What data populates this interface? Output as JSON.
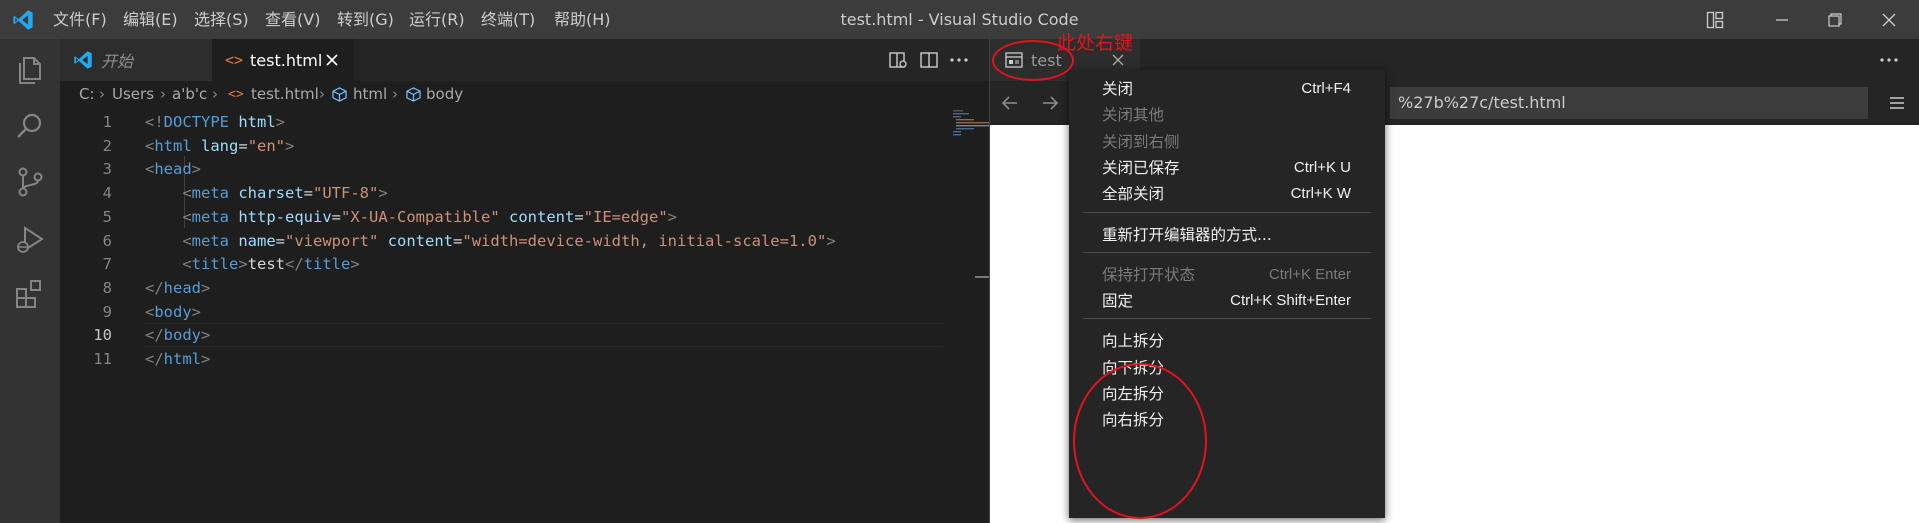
{
  "app": {
    "window_title": "test.html - Visual Studio Code",
    "menu": [
      "文件(F)",
      "编辑(E)",
      "选择(S)",
      "查看(V)",
      "转到(G)",
      "运行(R)",
      "终端(T)",
      "帮助(H)"
    ]
  },
  "activity_bar": {
    "items": [
      "files-icon",
      "search-icon",
      "source-control-icon",
      "run-debug-icon",
      "extensions-icon"
    ]
  },
  "left_editor": {
    "tabs": [
      {
        "label": "开始",
        "icon": "vscode-logo-icon",
        "active": false
      },
      {
        "label": "test.html",
        "icon": "html-file-icon",
        "active": true
      }
    ],
    "breadcrumb": [
      "C:",
      "Users",
      "a'b'c",
      "test.html",
      "html",
      "body"
    ],
    "current_line": 10,
    "lines": [
      [
        {
          "t": "punct",
          "v": "<!"
        },
        {
          "t": "tag",
          "v": "DOCTYPE"
        },
        {
          "t": "text",
          "v": " "
        },
        {
          "t": "attr",
          "v": "html"
        },
        {
          "t": "punct",
          "v": ">"
        }
      ],
      [
        {
          "t": "punct",
          "v": "<"
        },
        {
          "t": "tag",
          "v": "html"
        },
        {
          "t": "text",
          "v": " "
        },
        {
          "t": "attr",
          "v": "lang"
        },
        {
          "t": "text",
          "v": "="
        },
        {
          "t": "str",
          "v": "\"en\""
        },
        {
          "t": "punct",
          "v": ">"
        }
      ],
      [
        {
          "t": "punct",
          "v": "<"
        },
        {
          "t": "tag",
          "v": "head"
        },
        {
          "t": "punct",
          "v": ">"
        }
      ],
      [
        {
          "t": "text",
          "v": "    "
        },
        {
          "t": "punct",
          "v": "<"
        },
        {
          "t": "tag",
          "v": "meta"
        },
        {
          "t": "text",
          "v": " "
        },
        {
          "t": "attr",
          "v": "charset"
        },
        {
          "t": "text",
          "v": "="
        },
        {
          "t": "str",
          "v": "\"UTF-8\""
        },
        {
          "t": "punct",
          "v": ">"
        }
      ],
      [
        {
          "t": "text",
          "v": "    "
        },
        {
          "t": "punct",
          "v": "<"
        },
        {
          "t": "tag",
          "v": "meta"
        },
        {
          "t": "text",
          "v": " "
        },
        {
          "t": "attr",
          "v": "http-equiv"
        },
        {
          "t": "text",
          "v": "="
        },
        {
          "t": "str",
          "v": "\"X-UA-Compatible\""
        },
        {
          "t": "text",
          "v": " "
        },
        {
          "t": "attr",
          "v": "content"
        },
        {
          "t": "text",
          "v": "="
        },
        {
          "t": "str",
          "v": "\"IE=edge\""
        },
        {
          "t": "punct",
          "v": ">"
        }
      ],
      [
        {
          "t": "text",
          "v": "    "
        },
        {
          "t": "punct",
          "v": "<"
        },
        {
          "t": "tag",
          "v": "meta"
        },
        {
          "t": "text",
          "v": " "
        },
        {
          "t": "attr",
          "v": "name"
        },
        {
          "t": "text",
          "v": "="
        },
        {
          "t": "str",
          "v": "\"viewport\""
        },
        {
          "t": "text",
          "v": " "
        },
        {
          "t": "attr",
          "v": "content"
        },
        {
          "t": "text",
          "v": "="
        },
        {
          "t": "str",
          "v": "\"width=device-width, initial-scale=1.0\""
        },
        {
          "t": "punct",
          "v": ">"
        }
      ],
      [
        {
          "t": "text",
          "v": "    "
        },
        {
          "t": "punct",
          "v": "<"
        },
        {
          "t": "tag",
          "v": "title"
        },
        {
          "t": "punct",
          "v": ">"
        },
        {
          "t": "text",
          "v": "test"
        },
        {
          "t": "punct",
          "v": "</"
        },
        {
          "t": "tag",
          "v": "title"
        },
        {
          "t": "punct",
          "v": ">"
        }
      ],
      [
        {
          "t": "punct",
          "v": "</"
        },
        {
          "t": "tag",
          "v": "head"
        },
        {
          "t": "punct",
          "v": ">"
        }
      ],
      [
        {
          "t": "punct",
          "v": "<"
        },
        {
          "t": "tag",
          "v": "body"
        },
        {
          "t": "punct",
          "v": ">"
        }
      ],
      [
        {
          "t": "punct",
          "v": "</"
        },
        {
          "t": "tag",
          "v": "body"
        },
        {
          "t": "punct",
          "v": ">"
        }
      ],
      [
        {
          "t": "punct",
          "v": "</"
        },
        {
          "t": "tag",
          "v": "html"
        },
        {
          "t": "punct",
          "v": ">"
        }
      ]
    ]
  },
  "right_editor": {
    "tab": {
      "label": "test",
      "icon": "preview-icon"
    },
    "url_visible": "%27b%27c/test.html"
  },
  "annotation": {
    "text": "此处右键",
    "color": "#e0141e"
  },
  "context_menu": {
    "groups": [
      [
        {
          "label": "关闭",
          "key": "Ctrl+F4",
          "enabled": true
        },
        {
          "label": "关闭其他",
          "key": "",
          "enabled": false
        },
        {
          "label": "关闭到右侧",
          "key": "",
          "enabled": false
        },
        {
          "label": "关闭已保存",
          "key": "Ctrl+K U",
          "enabled": true
        },
        {
          "label": "全部关闭",
          "key": "Ctrl+K W",
          "enabled": true
        }
      ],
      [
        {
          "label": "重新打开编辑器的方式...",
          "key": "",
          "enabled": true
        }
      ],
      [
        {
          "label": "保持打开状态",
          "key": "Ctrl+K Enter",
          "enabled": false
        },
        {
          "label": "固定",
          "key": "Ctrl+K Shift+Enter",
          "enabled": true
        }
      ],
      [
        {
          "label": "向上拆分",
          "key": "",
          "enabled": true
        },
        {
          "label": "向下拆分",
          "key": "",
          "enabled": true
        },
        {
          "label": "向左拆分",
          "key": "",
          "enabled": true
        },
        {
          "label": "向右拆分",
          "key": "",
          "enabled": true
        }
      ]
    ]
  },
  "colors": {
    "accent": "#007acc",
    "annotation_red": "#e0141e",
    "html_icon": "#e37933"
  }
}
